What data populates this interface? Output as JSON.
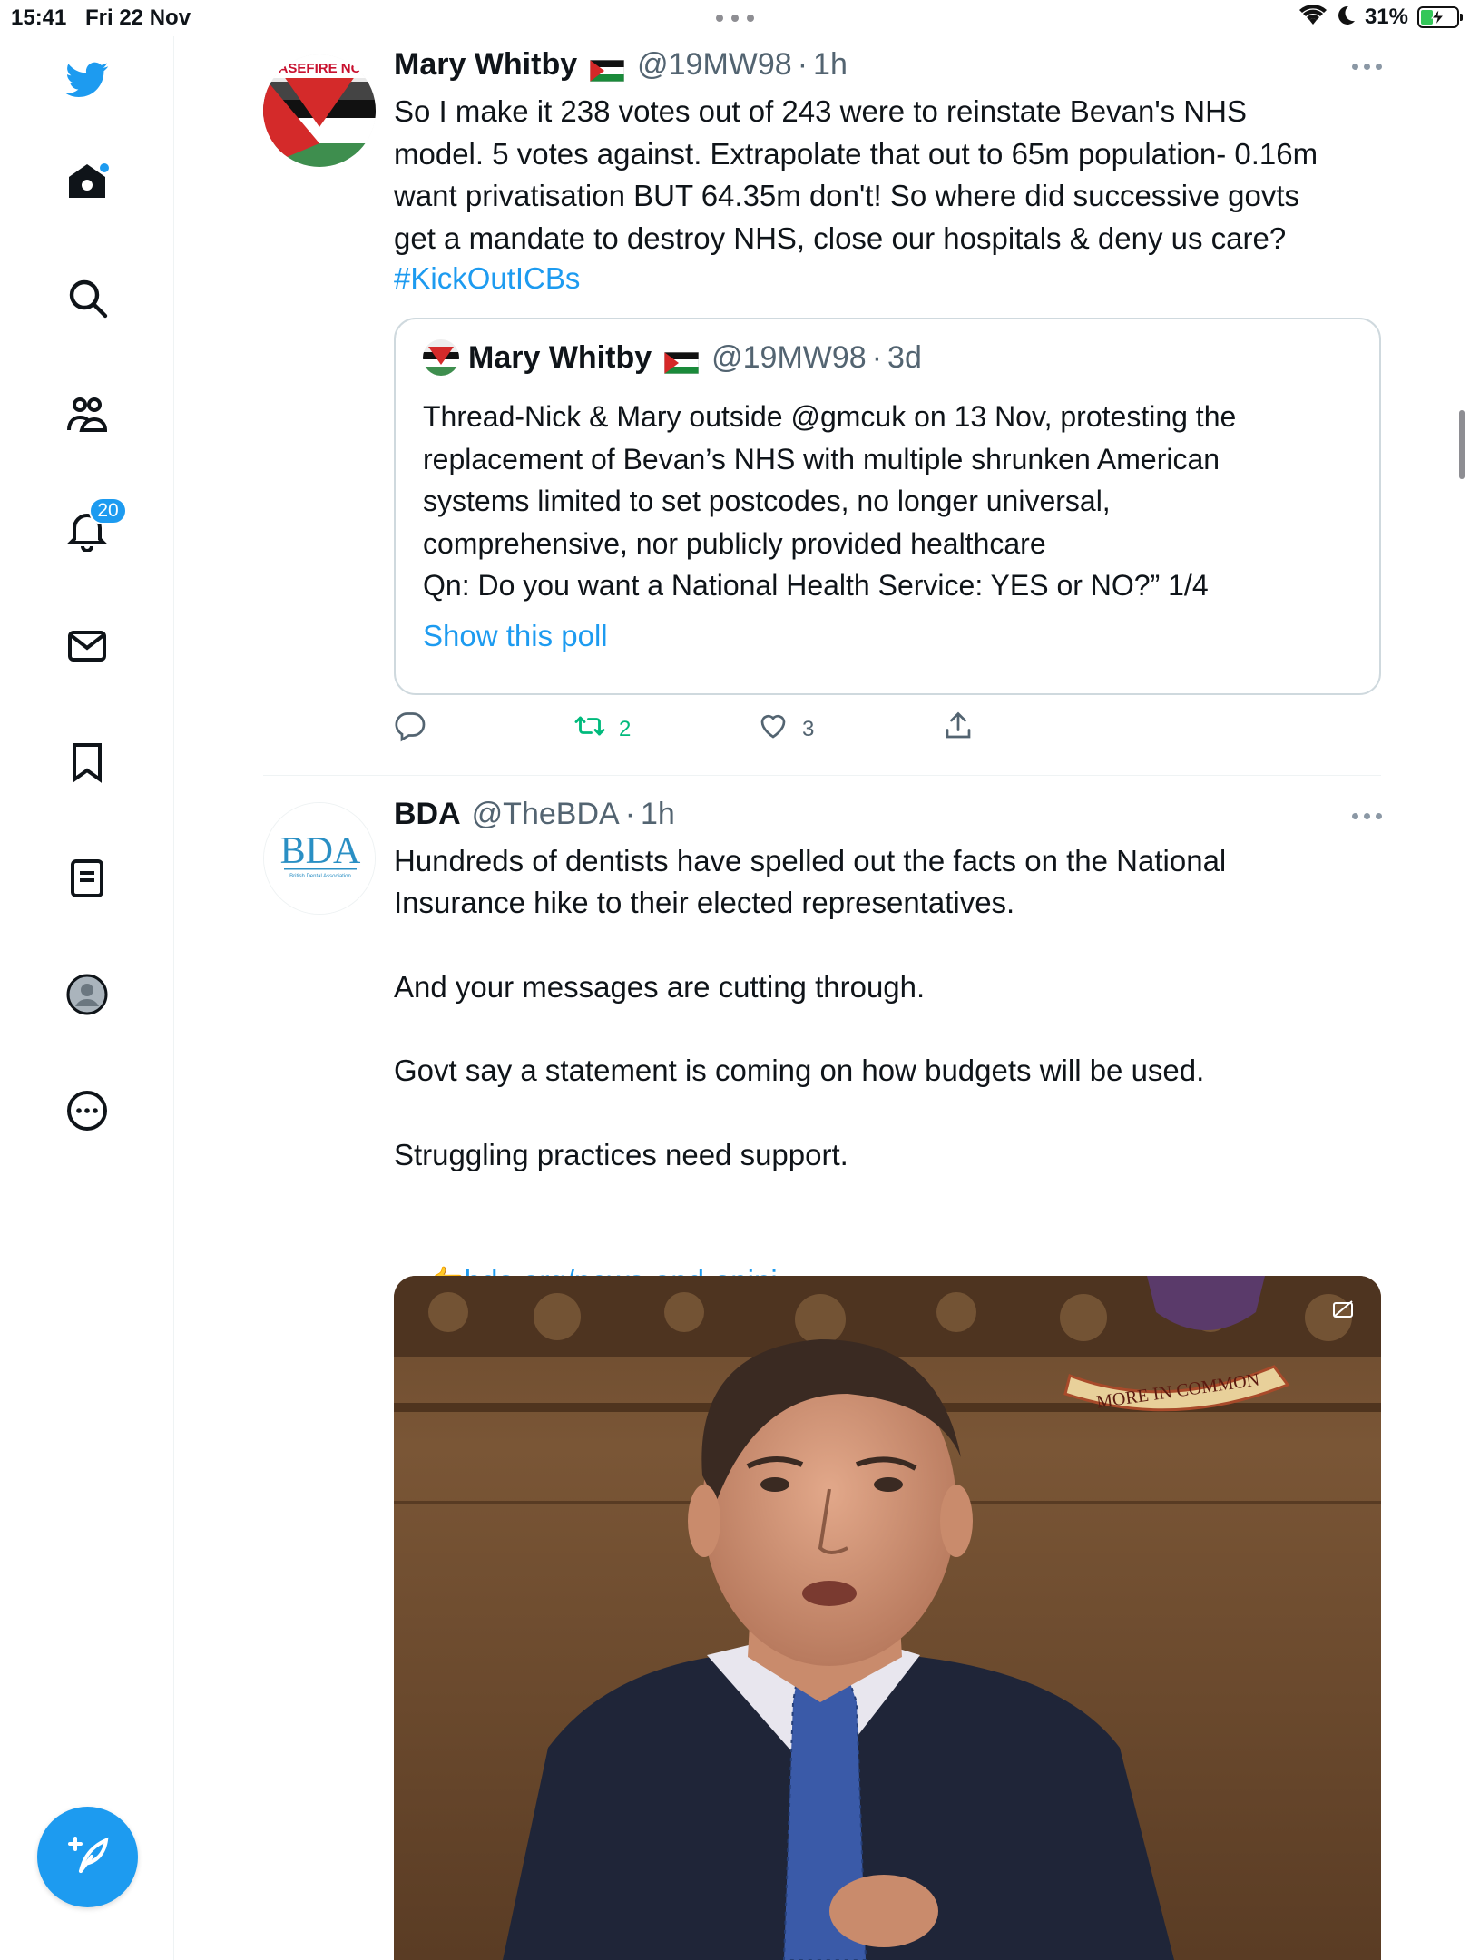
{
  "status_bar": {
    "time": "15:41",
    "date": "Fri 22 Nov",
    "battery_percent": "31%",
    "battery_level": 0.31
  },
  "sidebar": {
    "items": [
      {
        "icon": "twitter-bird-icon"
      },
      {
        "icon": "home-icon",
        "has_dot": true
      },
      {
        "icon": "search-icon"
      },
      {
        "icon": "communities-icon"
      },
      {
        "icon": "notifications-icon",
        "badge": "20"
      },
      {
        "icon": "messages-icon"
      },
      {
        "icon": "bookmarks-icon"
      },
      {
        "icon": "lists-icon"
      },
      {
        "icon": "profile-icon"
      },
      {
        "icon": "more-options-icon"
      }
    ],
    "compose_icon": "compose-tweet-icon"
  },
  "tweets": [
    {
      "author_name": "Mary Whitby",
      "handle": "@19MW98",
      "separator": "·",
      "time": "1h",
      "avatar_text": "ASEFIRE NC",
      "body": "So I make it 238 votes out of 243 were to reinstate Bevan's NHS\nmodel. 5 votes against. Extrapolate that out to 65m population- 0.16m\nwant privatisation BUT 64.35m don't! So where did successive govts\nget a mandate to destroy NHS, close our hospitals & deny us care?",
      "hashtag": "#KickOutICBs",
      "quote": {
        "author_name": "Mary Whitby",
        "handle": "@19MW98",
        "separator": "·",
        "time": "3d",
        "body": "Thread-Nick & Mary outside @gmcuk on 13 Nov, protesting the\nreplacement of Bevan’s NHS with multiple shrunken American\nsystems limited to set postcodes, no longer universal,\ncomprehensive, nor publicly provided healthcare\nQn: Do you want a National Health Service: YES or NO?” 1/4",
        "poll_link": "Show this poll"
      },
      "actions": {
        "replies": "",
        "retweets": "2",
        "likes": "3"
      },
      "retweet_color": "#00ba7c"
    },
    {
      "author_name": "BDA",
      "handle": "@TheBDA",
      "separator": "·",
      "time": "1h",
      "avatar_text": "BDA",
      "avatar_subtext": "British Dental Association",
      "body": "Hundreds of dentists have spelled out the facts on the National\nInsurance hike to their elected representatives.\n\nAnd your messages are cutting through.\n\nGovt say a statement is coming on how budgets will be used.\n\nStruggling practices need support.",
      "link_emoji": "👉",
      "link": "bda.org/news-and-opini…",
      "media": {
        "caption_text": "MORE IN COMMON",
        "icon": "media-settings-icon"
      }
    }
  ],
  "colors": {
    "accent": "#1d9bf0",
    "text": "#0f1419",
    "secondary_text": "#536471",
    "retweet": "#00ba7c"
  }
}
